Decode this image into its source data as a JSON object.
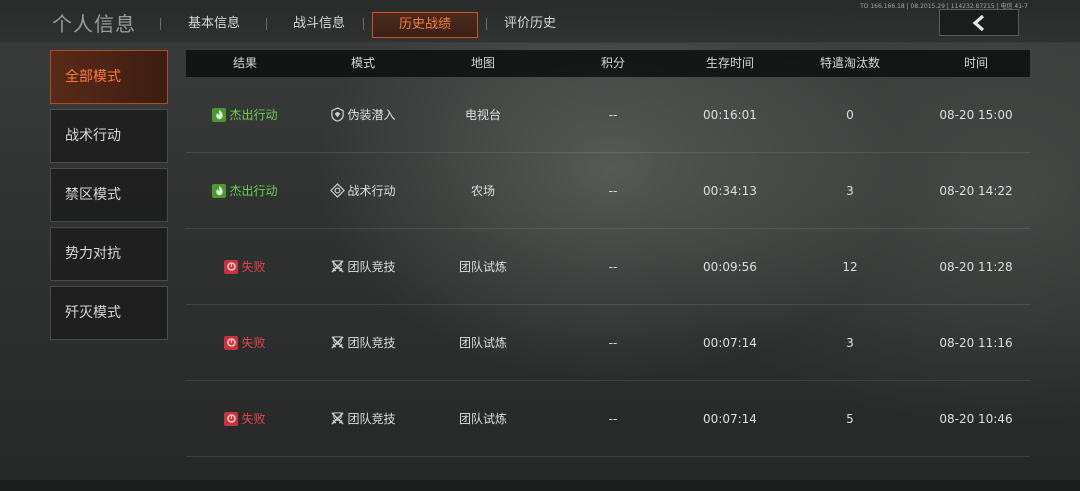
{
  "header": {
    "title": "个人信息",
    "tabs": [
      {
        "label": "基本信息",
        "active": false
      },
      {
        "label": "战斗信息",
        "active": false
      },
      {
        "label": "历史战绩",
        "active": true
      },
      {
        "label": "评价历史",
        "active": false
      }
    ],
    "sysinfo": "TO 166.166.18 | 08.2015.29 | 114232.87215 | 电信 41-7"
  },
  "sidebar": {
    "items": [
      {
        "label": "全部模式",
        "active": true
      },
      {
        "label": "战术行动",
        "active": false
      },
      {
        "label": "禁区模式",
        "active": false
      },
      {
        "label": "势力对抗",
        "active": false
      },
      {
        "label": "歼灭模式",
        "active": false
      }
    ]
  },
  "table": {
    "columns": [
      "结果",
      "模式",
      "地图",
      "积分",
      "生存时间",
      "特遣淘汰数",
      "时间"
    ],
    "rows": [
      {
        "result": "杰出行动",
        "result_type": "win",
        "mode": "伪装潜入",
        "mode_icon": "disguise-icon",
        "map": "电视台",
        "score": "--",
        "survival": "00:16:01",
        "kills": "0",
        "time": "08-20 15:00"
      },
      {
        "result": "杰出行动",
        "result_type": "win",
        "mode": "战术行动",
        "mode_icon": "tactical-icon",
        "map": "农场",
        "score": "--",
        "survival": "00:34:13",
        "kills": "3",
        "time": "08-20 14:22"
      },
      {
        "result": "失败",
        "result_type": "lose",
        "mode": "团队竞技",
        "mode_icon": "team-battle-icon",
        "map": "团队试炼",
        "score": "--",
        "survival": "00:09:56",
        "kills": "12",
        "time": "08-20 11:28"
      },
      {
        "result": "失败",
        "result_type": "lose",
        "mode": "团队竞技",
        "mode_icon": "team-battle-icon",
        "map": "团队试炼",
        "score": "--",
        "survival": "00:07:14",
        "kills": "3",
        "time": "08-20 11:16"
      },
      {
        "result": "失败",
        "result_type": "lose",
        "mode": "团队竞技",
        "mode_icon": "team-battle-icon",
        "map": "团队试炼",
        "score": "--",
        "survival": "00:07:14",
        "kills": "5",
        "time": "08-20 10:46"
      }
    ]
  },
  "colors": {
    "accent": "#ff7a3c",
    "win": "#6ed04f",
    "lose": "#e2444c"
  }
}
